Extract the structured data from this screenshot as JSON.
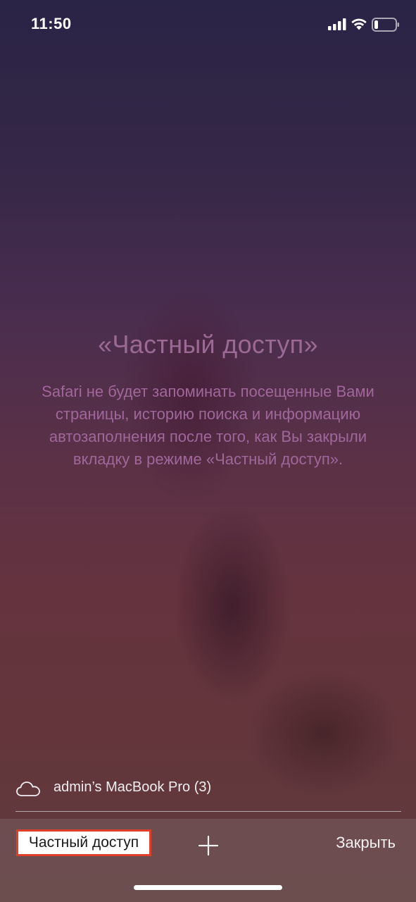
{
  "status_bar": {
    "time": "11:50",
    "icons": [
      "signal-icon",
      "wifi-icon",
      "battery-icon"
    ]
  },
  "private_browsing": {
    "heading": "«Частный доступ»",
    "description": "Safari не будет запоминать посещенные Вами страницы, историю поиска и информацию автозаполнения после того, как Вы закрыли вкладку в режиме «Частный доступ»."
  },
  "icloud_tabs": {
    "icon": "cloud-icon",
    "device_label": "admin’s MacBook Pro (3)"
  },
  "toolbar": {
    "private_label": "Частный доступ",
    "add_icon": "plus-icon",
    "close_label": "Закрыть"
  },
  "colors": {
    "heading_text": "#9a6a95",
    "description_text": "#a0679a",
    "highlight_border": "#e0402a"
  }
}
